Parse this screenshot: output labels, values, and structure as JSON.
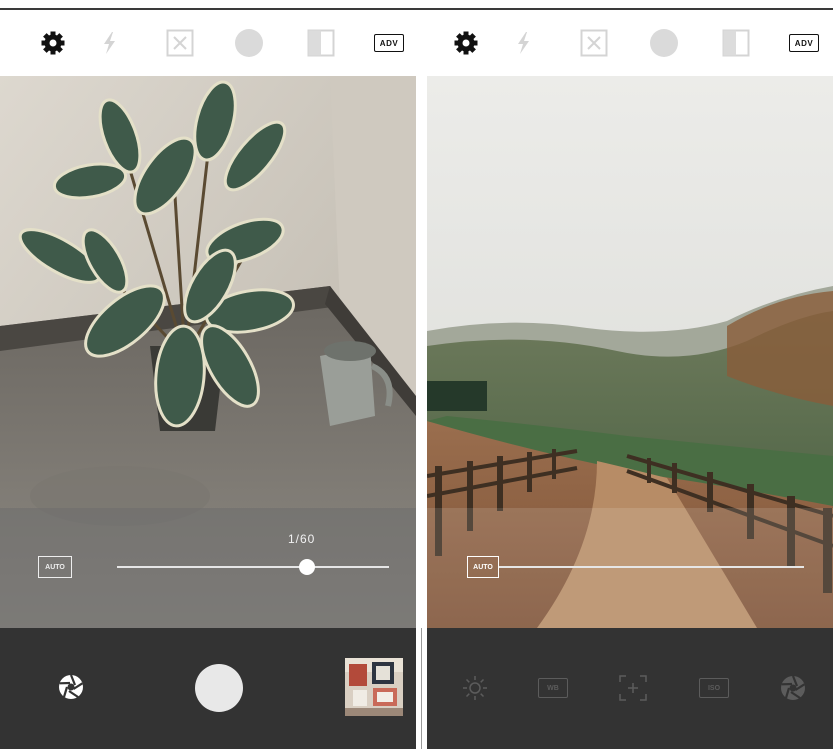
{
  "left_screen": {
    "toolbar": {
      "settings_icon": "gear-icon",
      "flash_icon": "flash-off-icon",
      "grid_icon": "grid-icon",
      "circle_icon": "circle-icon",
      "split_icon": "split-icon",
      "adv_label": "ADV"
    },
    "photo": "potted rubber plant with watering can",
    "controls": {
      "auto_label": "AUTO",
      "shutter_speed": "1/60",
      "slider_level": 0.7
    },
    "bottom": {
      "mode_icon": "aperture-icon",
      "capture_icon": "capture-button",
      "gallery_icon": "gallery-thumbnail"
    }
  },
  "right_screen": {
    "toolbar": {
      "settings_icon": "gear-icon",
      "flash_icon": "flash-off-icon",
      "grid_icon": "grid-icon",
      "circle_icon": "circle-icon",
      "split_icon": "split-icon",
      "adv_label": "ADV"
    },
    "photo": "misty hills with fenced dirt path",
    "controls": {
      "auto_label": "AUTO",
      "slider_level": 0.0
    },
    "bottom": {
      "exposure_icon": "brightness-icon",
      "wb_label": "WB",
      "focus_icon": "focus-icon",
      "iso_label": "ISO",
      "mode_icon": "aperture-icon"
    }
  },
  "colors": {
    "bottom_bar": "#333333",
    "icon_active": "#111111",
    "icon_inactive": "#d0d0d0",
    "overlay": "#6e6e6e"
  }
}
